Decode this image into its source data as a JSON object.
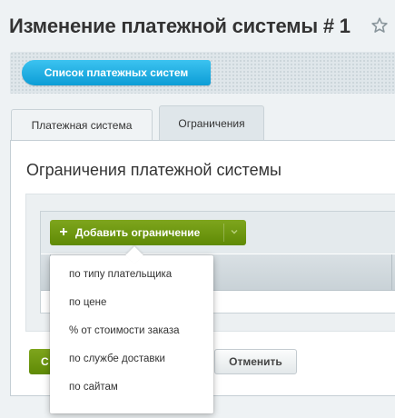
{
  "header": {
    "title": "Изменение платежной системы # 1",
    "star_icon": "star-outline-icon"
  },
  "toolbar": {
    "list_button_label": "Список платежных систем"
  },
  "tabs": [
    {
      "label": "Платежная система",
      "active": false
    },
    {
      "label": "Ограничения",
      "active": true
    }
  ],
  "panel": {
    "heading": "Ограничения платежной системы"
  },
  "grid": {
    "add_button_label": "Добавить ограничение",
    "add_icon": "plus-icon",
    "dropdown_icon": "chevron-down-icon"
  },
  "dropdown_menu": {
    "items": [
      "по типу плательщика",
      "по цене",
      "% от стоимости заказа",
      "по службе доставки",
      "по сайтам"
    ]
  },
  "footer": {
    "save_label_partial": "С",
    "cancel_label": "Отменить"
  },
  "colors": {
    "accent_blue": "#1aa9e1",
    "accent_green": "#6e9612",
    "background": "#eef2f4"
  }
}
